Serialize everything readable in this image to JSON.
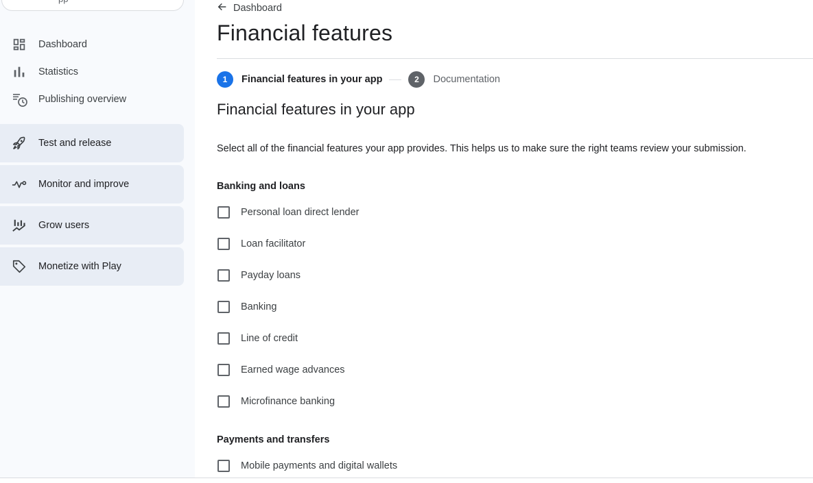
{
  "sidebar": {
    "app_pill_text": "pp",
    "items": [
      {
        "label": "Dashboard",
        "icon": "dashboard-icon"
      },
      {
        "label": "Statistics",
        "icon": "bar-chart-icon"
      },
      {
        "label": "Publishing overview",
        "icon": "schedule-list-icon"
      }
    ],
    "groups": [
      {
        "label": "Test and release",
        "icon": "rocket-icon"
      },
      {
        "label": "Monitor and improve",
        "icon": "vitals-icon"
      },
      {
        "label": "Grow users",
        "icon": "growth-chart-icon"
      },
      {
        "label": "Monetize with Play",
        "icon": "tag-icon"
      }
    ]
  },
  "header": {
    "back_label": "Dashboard",
    "title": "Financial features"
  },
  "stepper": {
    "steps": [
      {
        "number": "1",
        "label": "Financial features in your app",
        "state": "active"
      },
      {
        "number": "2",
        "label": "Documentation",
        "state": "inactive"
      }
    ]
  },
  "content": {
    "section_title": "Financial features in your app",
    "description": "Select all of the financial features your app provides. This helps us to make sure the right teams review your submission.",
    "groups": [
      {
        "heading": "Banking and loans",
        "options": [
          {
            "label": "Personal loan direct lender",
            "checked": false
          },
          {
            "label": "Loan facilitator",
            "checked": false
          },
          {
            "label": "Payday loans",
            "checked": false
          },
          {
            "label": "Banking",
            "checked": false
          },
          {
            "label": "Line of credit",
            "checked": false
          },
          {
            "label": "Earned wage advances",
            "checked": false
          },
          {
            "label": "Microfinance banking",
            "checked": false
          }
        ]
      },
      {
        "heading": "Payments and transfers",
        "options": [
          {
            "label": "Mobile payments and digital wallets",
            "checked": false
          }
        ]
      }
    ]
  },
  "colors": {
    "accent": "#1a73e8",
    "sidebar_bg": "#f8fafd",
    "nav_group_bg": "#e8edf5"
  }
}
